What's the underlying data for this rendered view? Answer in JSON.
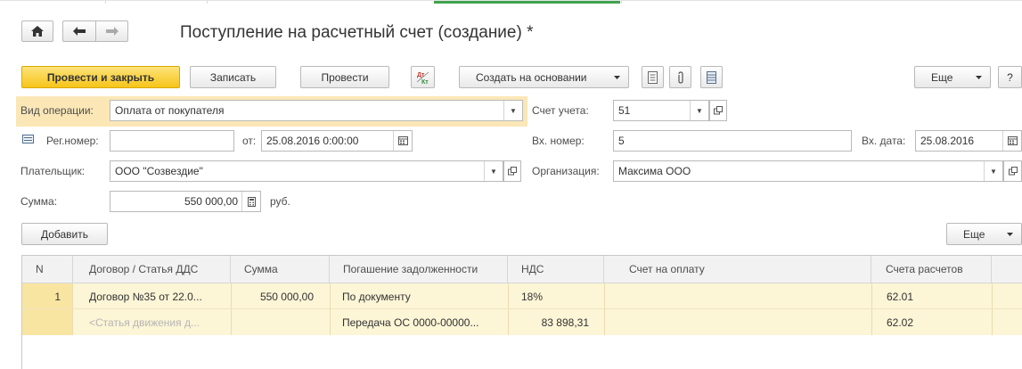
{
  "window_title": "Поступление на расчетный счет (создание) *",
  "nav": {
    "home": "home-icon",
    "back": "arrow-left-icon",
    "forward": "arrow-right-icon"
  },
  "toolbar": {
    "post_and_close": "Провести и закрыть",
    "save": "Записать",
    "post": "Провести",
    "dt_kt_icon_text": [
      "Дт",
      "Кт"
    ],
    "create_based_on": "Создать на основании",
    "more": "Еще",
    "help": "?"
  },
  "form": {
    "operation_type_label": "Вид операции:",
    "operation_type_value": "Оплата от покупателя",
    "account_label": "Счет учета:",
    "account_value": "51",
    "reg_number_label": "Рег.номер:",
    "reg_number_value": "",
    "from_label": "от:",
    "date_value": "25.08.2016  0:00:00",
    "in_number_label": "Вх. номер:",
    "in_number_value": "5",
    "in_date_label": "Вх. дата:",
    "in_date_value": "25.08.2016",
    "payer_label": "Плательщик:",
    "payer_value": "ООО \"Созвездие\"",
    "org_label": "Организация:",
    "org_value": "Максима ООО",
    "amount_label": "Сумма:",
    "amount_value": "550 000,00",
    "currency": "руб."
  },
  "table_toolbar": {
    "add": "Добавить",
    "more": "Еще"
  },
  "table": {
    "columns": [
      "N",
      "Договор / Статья ДДС",
      "Сумма",
      "Погашение задолженности",
      "НДС",
      "Счет на оплату",
      "Счета расчетов"
    ],
    "rows": [
      {
        "n": "1",
        "contract": "Договор №35 от 22.0...",
        "contract_sub": "<Статья движения д...",
        "amount": "550 000,00",
        "repayment": "По документу",
        "repayment_sub": "Передача ОС 0000-00000...",
        "vat": "18%",
        "vat_sub": "83 898,31",
        "invoice": "",
        "accounts": "62.01",
        "accounts_sub": "62.02"
      }
    ]
  }
}
